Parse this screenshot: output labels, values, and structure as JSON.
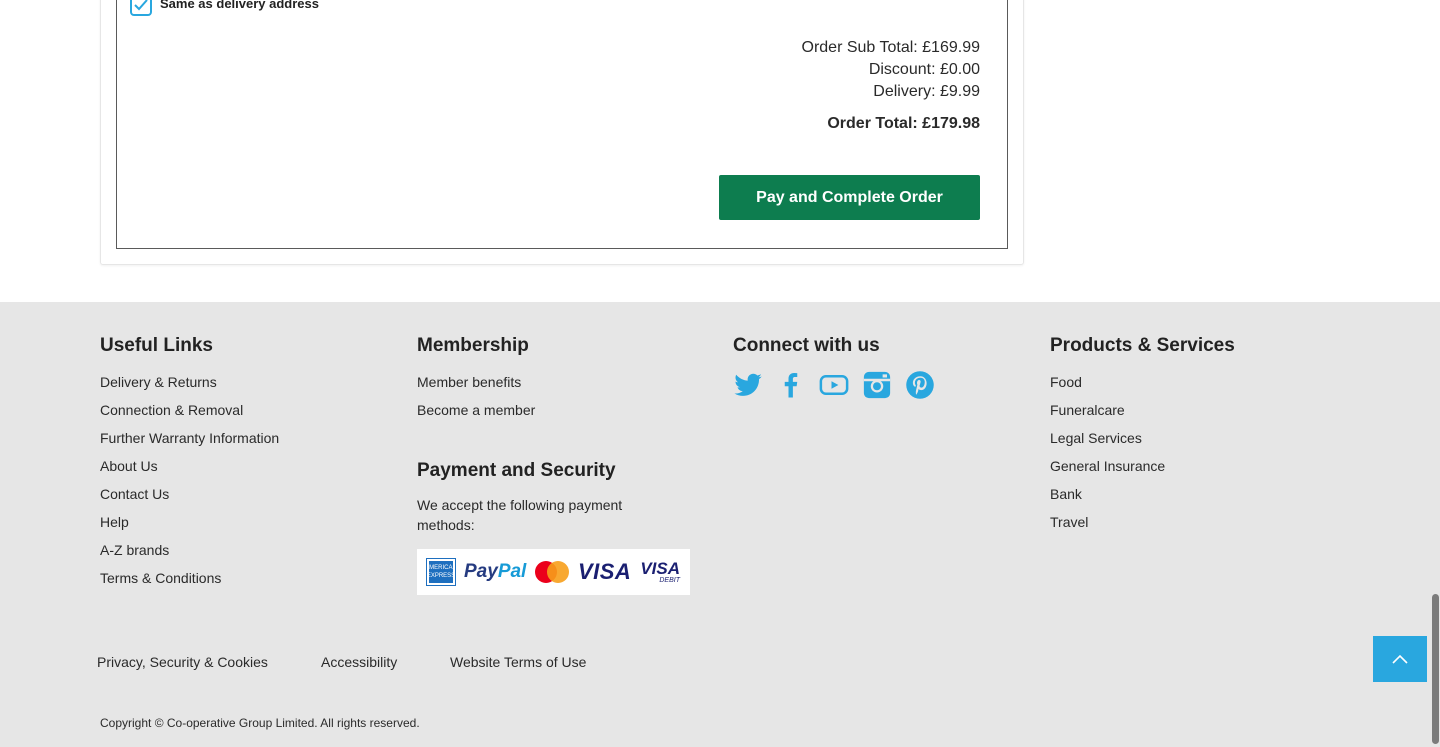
{
  "checkout": {
    "billing_checkbox_label": "Same as delivery address",
    "billing_checked": true,
    "sub_total": "Order Sub Total: £169.99",
    "discount": "Discount: £0.00",
    "delivery": "Delivery: £9.99",
    "order_total": "Order Total: £179.98",
    "pay_button": "Pay and Complete Order"
  },
  "footer": {
    "useful_links": {
      "heading": "Useful Links",
      "items": [
        "Delivery & Returns",
        "Connection & Removal",
        "Further Warranty Information",
        "About Us",
        "Contact Us",
        "Help",
        "A-Z brands",
        "Terms & Conditions"
      ]
    },
    "membership": {
      "heading": "Membership",
      "items": [
        "Member benefits",
        "Become a member"
      ]
    },
    "payment": {
      "heading": "Payment and Security",
      "text": "We accept the following payment methods:",
      "logos": [
        "amex-logo",
        "paypal-logo",
        "mastercard-logo",
        "visa-logo",
        "visa-debit-logo"
      ],
      "logo_text": {
        "amex": "AMERICAN EXPRESS",
        "paypal_1": "Pay",
        "paypal_2": "Pal",
        "visa": "VISA",
        "visa_debit_1": "VISA",
        "visa_debit_2": "DEBIT"
      }
    },
    "connect": {
      "heading": "Connect with us",
      "icons": [
        "twitter-icon",
        "facebook-icon",
        "youtube-icon",
        "instagram-icon",
        "pinterest-icon"
      ]
    },
    "products": {
      "heading": "Products & Services",
      "items": [
        "Food",
        "Funeralcare",
        "Legal Services",
        "General Insurance",
        "Bank",
        "Travel"
      ]
    },
    "legal": {
      "privacy": "Privacy, Security & Cookies",
      "accessibility": "Accessibility",
      "terms": "Website Terms of Use"
    },
    "copyright": "Copyright © Co-operative Group Limited. All rights reserved."
  },
  "colors": {
    "accent_blue": "#29a7df",
    "pay_green": "#0d7d4f",
    "footer_bg": "#e6e6e6"
  }
}
